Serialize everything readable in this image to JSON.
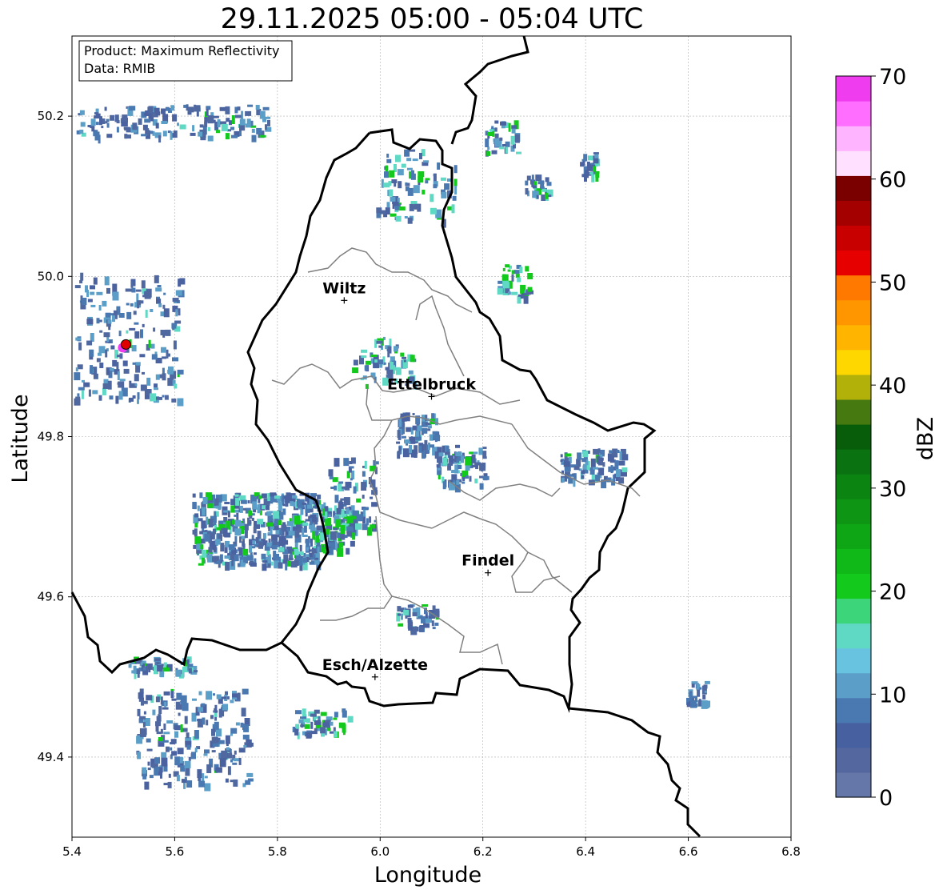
{
  "title": "29.11.2025 05:00 - 05:04 UTC",
  "info_box": {
    "line1": "Product: Maximum Reflectivity",
    "line2": "Data: RMIB"
  },
  "axes": {
    "xlabel": "Longitude",
    "ylabel": "Latitude",
    "xlim": [
      5.4,
      6.8
    ],
    "ylim": [
      49.3,
      50.3
    ],
    "xticks": [
      "5.4",
      "5.6",
      "5.8",
      "6.0",
      "6.2",
      "6.4",
      "6.6",
      "6.8"
    ],
    "yticks": [
      "49.4",
      "49.6",
      "49.8",
      "50.0",
      "50.2"
    ],
    "grid": true
  },
  "cities": [
    {
      "name": "Wiltz",
      "lon": 5.93,
      "lat": 49.97
    },
    {
      "name": "Ettelbruck",
      "lon": 6.1,
      "lat": 49.85
    },
    {
      "name": "Findel",
      "lon": 6.21,
      "lat": 49.63
    },
    {
      "name": "Esch/Alzette",
      "lon": 5.99,
      "lat": 49.5
    }
  ],
  "radar_site": {
    "lon": 5.505,
    "lat": 49.915,
    "color": "#e00000"
  },
  "colorbar": {
    "label": "dBZ",
    "min": 0,
    "max": 70,
    "tick_labels": [
      "0",
      "10",
      "20",
      "30",
      "40",
      "50",
      "60",
      "70"
    ],
    "colors": [
      "#6577a8",
      "#54679e",
      "#4660a0",
      "#4a78b0",
      "#5b9ec8",
      "#67c3df",
      "#5fd8c4",
      "#3dd57a",
      "#13c91c",
      "#10b818",
      "#0fa616",
      "#0e9514",
      "#0c8412",
      "#0a7210",
      "#075d0a",
      "#467a10",
      "#b1b10a",
      "#ffd700",
      "#ffb400",
      "#ff9600",
      "#ff7800",
      "#e60000",
      "#c80000",
      "#a50000",
      "#7a0000",
      "#ffe0ff",
      "#ffb4ff",
      "#ff6eff",
      "#ee3cee"
    ]
  }
}
